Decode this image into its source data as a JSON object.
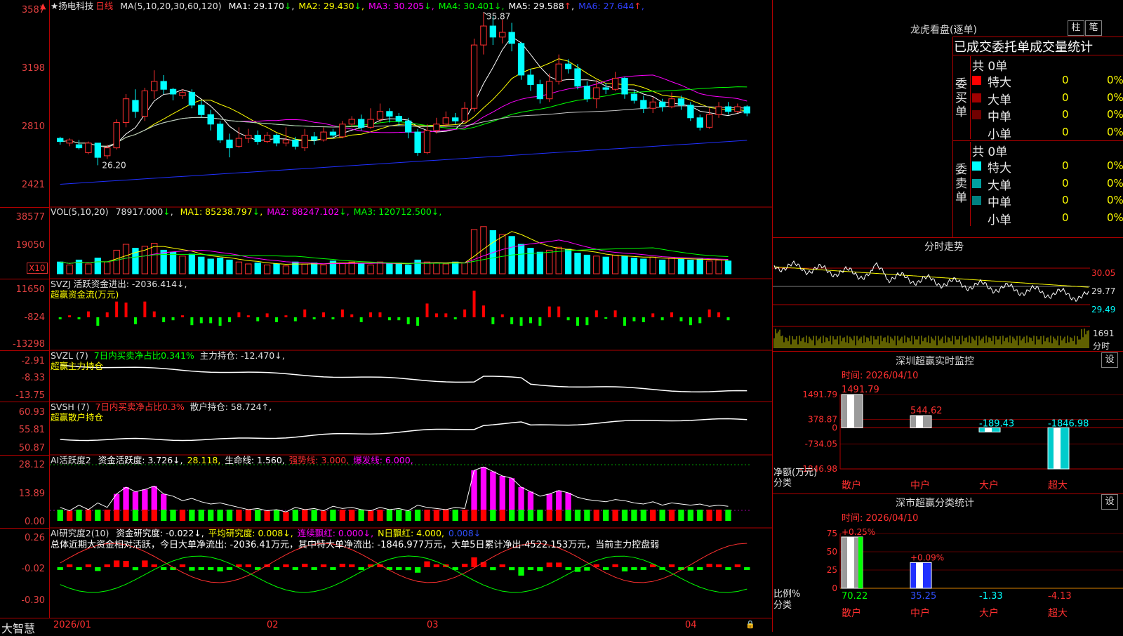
{
  "app": {
    "brand": "大智慧",
    "stock_name": "扬电科技",
    "period": "日线"
  },
  "time_axis": {
    "labels": [
      "2026/01",
      "02",
      "03",
      "04"
    ]
  },
  "price_pane": {
    "ma_text": "MA(5,10,20,30,60,120)",
    "ma": [
      {
        "label": "MA1:",
        "value": "29.170",
        "arrow": "↓",
        "color": "#ffffff"
      },
      {
        "label": "MA2:",
        "value": "29.430",
        "arrow": "↓",
        "color": "#ffff00"
      },
      {
        "label": "MA3:",
        "value": "30.205",
        "arrow": "↓",
        "color": "#ff00ff"
      },
      {
        "label": "MA4:",
        "value": "30.401",
        "arrow": "↓",
        "color": "#00ff00"
      },
      {
        "label": "MA5:",
        "value": "29.588",
        "arrow": "↑",
        "color": "#ffffff"
      },
      {
        "label": "MA6:",
        "value": "27.644",
        "arrow": "↑",
        "color": "#3040ff"
      }
    ],
    "y_ticks": [
      "3587",
      "3198",
      "2810",
      "2421"
    ],
    "high_label": "35.87",
    "low_label": "26.20"
  },
  "vol_pane": {
    "label": "VOL(5,10,20)",
    "value": "78917.000",
    "value_arrow": "↓",
    "ma": [
      {
        "label": "MA1:",
        "value": "85238.797",
        "arrow": "↓",
        "color": "#ffff00"
      },
      {
        "label": "MA2:",
        "value": "88247.102",
        "arrow": "↓",
        "color": "#ff00ff"
      },
      {
        "label": "MA3:",
        "value": "120712.500",
        "arrow": "↓",
        "color": "#00ff00"
      }
    ],
    "y_ticks": [
      "38577",
      "19050"
    ],
    "unit": "X10"
  },
  "svzj_pane": {
    "line1": "SVZJ  活跃资金进出: -2036.414↓,",
    "line2": "超赢资金流(万元)",
    "y_ticks": [
      "11650",
      "-824",
      "-13298"
    ]
  },
  "svzl_pane": {
    "prefix": "SVZL (7)",
    "desc": "7日内买卖净占比0.341%",
    "main": "主力持仓: -12.470↓,",
    "line2": "超赢主力持仓",
    "y_ticks": [
      "-2.91",
      "-8.33",
      "-13.75"
    ]
  },
  "svsh_pane": {
    "prefix": "SVSH (7)",
    "desc": "7日内买卖净占比0.3%",
    "main": "散户持仓: 58.724↑,",
    "line2": "超赢散户持仓",
    "y_ticks": [
      "60.93",
      "55.81",
      "50.87"
    ]
  },
  "ai_active_pane": {
    "prefix": "AI活跃度2",
    "items": [
      {
        "text": "资金活跃度: 3.726↓,",
        "color": "#ffffff"
      },
      {
        "text": "28.118,",
        "color": "#ffff00"
      },
      {
        "text": "生命线: 1.560,",
        "color": "#ffffff"
      },
      {
        "text": "强势线: 3.000,",
        "color": "#ff3030"
      },
      {
        "text": "爆发线: 6.000,",
        "color": "#ff00ff"
      }
    ],
    "y_ticks": [
      "28.12",
      "13.89",
      "0.00"
    ]
  },
  "ai_research_pane": {
    "prefix": "AI研究度2(10)",
    "items": [
      {
        "text": "资金研究度: -0.022↓,",
        "color": "#ffffff"
      },
      {
        "text": "平均研究度: 0.008↓,",
        "color": "#ffff00"
      },
      {
        "text": "连续飘红: 0.000↓,",
        "color": "#ff00ff"
      },
      {
        "text": "N日飘红: 4.000,",
        "color": "#ffff00"
      },
      {
        "text": "0.008↓",
        "color": "#3050ff"
      }
    ],
    "summary": "总体近期大资金相对活跃，今日大单净流出: -2036.41万元，其中特大单净流出: -1846.977万元，大单5日累计净出-4522.153万元，当前主力控盘弱",
    "y_ticks": [
      "0.26",
      "-0.02",
      "-0.30"
    ]
  },
  "dragon_tiger": {
    "title": "龙虎看盘(逐单)",
    "btn_bar": "柱",
    "btn_pen": "笔",
    "header": "已成交委托单成交量统计",
    "buy_side": {
      "label": "委买单",
      "total": "共 0单",
      "rows": [
        {
          "name": "特大",
          "value": "0",
          "pct": "0%",
          "color": "#ff0000"
        },
        {
          "name": "大单",
          "value": "0",
          "pct": "0%",
          "color": "#a00000"
        },
        {
          "name": "中单",
          "value": "0",
          "pct": "0%",
          "color": "#700000"
        },
        {
          "name": "小单",
          "value": "0",
          "pct": "0%",
          "color": ""
        }
      ]
    },
    "sell_side": {
      "label": "委卖单",
      "total": "共 0单",
      "rows": [
        {
          "name": "特大",
          "value": "0",
          "pct": "0%",
          "color": "#00ffff"
        },
        {
          "name": "大单",
          "value": "0",
          "pct": "0%",
          "color": "#00a0a0"
        },
        {
          "name": "中单",
          "value": "0",
          "pct": "0%",
          "color": "#008080"
        },
        {
          "name": "小单",
          "value": "0",
          "pct": "0%",
          "color": ""
        }
      ]
    }
  },
  "intraday": {
    "title": "分时走势",
    "price_ticks": [
      "30.05",
      "29.77",
      "29.49"
    ],
    "vol_label": "1691",
    "vol_unit": "分时"
  },
  "sz_monitor": {
    "title": "深圳超赢实时监控",
    "btn": "设",
    "time": "时间: 2026/04/10",
    "y_ticks": [
      "1491.79",
      "378.87",
      "0",
      "-734.05",
      "-1846.98"
    ],
    "y_unit_line1": "净额(万元)",
    "y_unit_line2": "分类",
    "bars": [
      {
        "category": "散户",
        "value": "1491.79"
      },
      {
        "category": "中户",
        "value": "544.62"
      },
      {
        "category": "大户",
        "value": "-189.43"
      },
      {
        "category": "超大",
        "value": "-1846.98"
      }
    ]
  },
  "sz_classify": {
    "title": "深市超赢分类统计",
    "btn": "设",
    "time": "时间: 2026/04/10",
    "y_ticks": [
      "75",
      "50",
      "25",
      "0"
    ],
    "y_unit_line1": "比例%",
    "y_unit_line2": "分类",
    "bars": [
      {
        "category": "散户",
        "value": "70.22",
        "top_label": "+0.25%"
      },
      {
        "category": "中户",
        "value": "35.25",
        "top_label": "+0.09%"
      },
      {
        "category": "大户",
        "value": "-1.33",
        "top_label": ""
      },
      {
        "category": "超大",
        "value": "-4.13",
        "top_label": ""
      }
    ]
  },
  "chart_data": {
    "type": "bar",
    "title": "深圳超赢实时监控",
    "categories": [
      "散户",
      "中户",
      "大户",
      "超大"
    ],
    "values": [
      1491.79,
      544.62,
      -189.43,
      -1846.98
    ],
    "ylabel": "净额(万元)",
    "ylim": [
      -1846.98,
      1491.79
    ],
    "candles": [
      {
        "o": 27.9,
        "c": 27.7,
        "h": 28.0,
        "l": 27.5
      },
      {
        "o": 27.6,
        "c": 27.8,
        "h": 27.9,
        "l": 27.4
      },
      {
        "o": 27.5,
        "c": 27.3,
        "h": 27.8,
        "l": 27.2
      },
      {
        "o": 27.0,
        "c": 27.6,
        "h": 27.7,
        "l": 26.9
      },
      {
        "o": 27.6,
        "c": 26.7,
        "h": 27.6,
        "l": 26.2
      },
      {
        "o": 26.8,
        "c": 27.3,
        "h": 27.5,
        "l": 26.6
      },
      {
        "o": 27.3,
        "c": 28.9,
        "h": 29.1,
        "l": 27.2
      },
      {
        "o": 28.9,
        "c": 30.4,
        "h": 30.7,
        "l": 28.6
      },
      {
        "o": 30.3,
        "c": 29.6,
        "h": 31.0,
        "l": 29.2
      },
      {
        "o": 29.3,
        "c": 30.9,
        "h": 31.1,
        "l": 29.0
      },
      {
        "o": 30.9,
        "c": 31.5,
        "h": 32.2,
        "l": 30.4
      },
      {
        "o": 31.5,
        "c": 31.0,
        "h": 31.9,
        "l": 30.7
      },
      {
        "o": 31.0,
        "c": 30.7,
        "h": 31.1,
        "l": 30.3
      },
      {
        "o": 30.6,
        "c": 30.8,
        "h": 31.0,
        "l": 30.4
      },
      {
        "o": 30.8,
        "c": 30.0,
        "h": 31.0,
        "l": 29.8
      },
      {
        "o": 30.0,
        "c": 29.4,
        "h": 30.3,
        "l": 29.2
      },
      {
        "o": 29.4,
        "c": 28.8,
        "h": 29.7,
        "l": 28.4
      },
      {
        "o": 28.8,
        "c": 27.8,
        "h": 29.0,
        "l": 27.6
      },
      {
        "o": 27.8,
        "c": 27.3,
        "h": 28.2,
        "l": 26.7
      },
      {
        "o": 27.4,
        "c": 27.9,
        "h": 28.6,
        "l": 27.3
      },
      {
        "o": 27.9,
        "c": 28.1,
        "h": 28.5,
        "l": 27.6
      },
      {
        "o": 28.1,
        "c": 27.7,
        "h": 28.4,
        "l": 27.5
      },
      {
        "o": 27.7,
        "c": 28.1,
        "h": 28.3,
        "l": 27.6
      },
      {
        "o": 28.1,
        "c": 27.6,
        "h": 28.2,
        "l": 27.4
      },
      {
        "o": 27.6,
        "c": 27.8,
        "h": 28.6,
        "l": 27.4
      },
      {
        "o": 27.8,
        "c": 27.4,
        "h": 28.0,
        "l": 27.2
      },
      {
        "o": 27.3,
        "c": 28.1,
        "h": 28.5,
        "l": 27.1
      },
      {
        "o": 28.0,
        "c": 27.8,
        "h": 28.3,
        "l": 27.5
      },
      {
        "o": 27.8,
        "c": 28.3,
        "h": 28.6,
        "l": 27.7
      },
      {
        "o": 28.3,
        "c": 28.1,
        "h": 28.5,
        "l": 27.9
      },
      {
        "o": 28.0,
        "c": 28.8,
        "h": 29.0,
        "l": 27.9
      },
      {
        "o": 28.8,
        "c": 29.1,
        "h": 29.3,
        "l": 28.6
      },
      {
        "o": 29.1,
        "c": 28.6,
        "h": 29.4,
        "l": 28.4
      },
      {
        "o": 28.6,
        "c": 29.1,
        "h": 29.8,
        "l": 28.5
      },
      {
        "o": 29.1,
        "c": 29.6,
        "h": 30.1,
        "l": 28.9
      },
      {
        "o": 29.6,
        "c": 29.3,
        "h": 29.8,
        "l": 28.9
      },
      {
        "o": 29.3,
        "c": 29.0,
        "h": 29.5,
        "l": 28.7
      },
      {
        "o": 29.0,
        "c": 28.3,
        "h": 29.2,
        "l": 27.9
      },
      {
        "o": 28.3,
        "c": 27.0,
        "h": 28.5,
        "l": 26.8
      },
      {
        "o": 27.0,
        "c": 28.4,
        "h": 28.8,
        "l": 26.9
      },
      {
        "o": 28.4,
        "c": 28.8,
        "h": 29.2,
        "l": 28.2
      },
      {
        "o": 28.8,
        "c": 29.2,
        "h": 29.6,
        "l": 28.6
      },
      {
        "o": 29.2,
        "c": 29.0,
        "h": 29.5,
        "l": 28.8
      },
      {
        "o": 29.0,
        "c": 29.8,
        "h": 30.2,
        "l": 28.9
      },
      {
        "o": 29.8,
        "c": 33.8,
        "h": 34.2,
        "l": 29.6
      },
      {
        "o": 33.8,
        "c": 35.0,
        "h": 35.87,
        "l": 33.2
      },
      {
        "o": 35.0,
        "c": 34.3,
        "h": 35.6,
        "l": 33.8
      },
      {
        "o": 34.3,
        "c": 34.6,
        "h": 35.4,
        "l": 33.9
      },
      {
        "o": 34.6,
        "c": 33.9,
        "h": 35.2,
        "l": 33.4
      },
      {
        "o": 33.9,
        "c": 31.9,
        "h": 34.0,
        "l": 31.6
      },
      {
        "o": 31.9,
        "c": 31.3,
        "h": 32.3,
        "l": 30.9
      },
      {
        "o": 31.3,
        "c": 30.4,
        "h": 31.6,
        "l": 30.1
      },
      {
        "o": 30.4,
        "c": 31.5,
        "h": 32.0,
        "l": 30.2
      },
      {
        "o": 31.5,
        "c": 32.6,
        "h": 33.2,
        "l": 31.3
      },
      {
        "o": 32.6,
        "c": 32.3,
        "h": 32.9,
        "l": 32.0
      },
      {
        "o": 32.3,
        "c": 31.2,
        "h": 32.6,
        "l": 31.0
      },
      {
        "o": 31.2,
        "c": 30.4,
        "h": 31.5,
        "l": 30.2
      },
      {
        "o": 30.4,
        "c": 31.1,
        "h": 31.6,
        "l": 29.8
      },
      {
        "o": 31.1,
        "c": 31.0,
        "h": 31.4,
        "l": 30.7
      },
      {
        "o": 31.0,
        "c": 31.7,
        "h": 32.1,
        "l": 30.9
      },
      {
        "o": 31.7,
        "c": 30.7,
        "h": 31.8,
        "l": 30.4
      },
      {
        "o": 30.7,
        "c": 30.3,
        "h": 31.0,
        "l": 30.1
      },
      {
        "o": 30.3,
        "c": 29.8,
        "h": 30.6,
        "l": 29.5
      },
      {
        "o": 29.8,
        "c": 30.2,
        "h": 30.5,
        "l": 29.5
      },
      {
        "o": 30.2,
        "c": 29.9,
        "h": 30.4,
        "l": 29.6
      },
      {
        "o": 29.9,
        "c": 30.4,
        "h": 30.8,
        "l": 29.8
      },
      {
        "o": 30.4,
        "c": 30.0,
        "h": 30.6,
        "l": 29.7
      },
      {
        "o": 30.0,
        "c": 29.2,
        "h": 30.2,
        "l": 29.0
      },
      {
        "o": 29.2,
        "c": 28.6,
        "h": 29.4,
        "l": 28.4
      },
      {
        "o": 28.6,
        "c": 29.4,
        "h": 29.8,
        "l": 28.5
      },
      {
        "o": 29.4,
        "c": 29.9,
        "h": 30.2,
        "l": 29.2
      },
      {
        "o": 29.9,
        "c": 29.6,
        "h": 30.2,
        "l": 29.4
      },
      {
        "o": 29.6,
        "c": 29.9,
        "h": 30.1,
        "l": 29.5
      },
      {
        "o": 29.9,
        "c": 29.5,
        "h": 30.0,
        "l": 29.3
      }
    ],
    "volumes": [
      12,
      9,
      14,
      10,
      16,
      12,
      24,
      30,
      26,
      28,
      31,
      24,
      22,
      18,
      20,
      17,
      15,
      16,
      14,
      12,
      10,
      11,
      9,
      10,
      8,
      12,
      10,
      11,
      9,
      13,
      11,
      12,
      10,
      9,
      12,
      10,
      11,
      9,
      14,
      12,
      11,
      10,
      12,
      11,
      45,
      48,
      44,
      40,
      38,
      30,
      26,
      22,
      24,
      27,
      25,
      21,
      19,
      18,
      17,
      19,
      18,
      16,
      15,
      17,
      14,
      16,
      15,
      14,
      15,
      13,
      14,
      13
    ]
  }
}
